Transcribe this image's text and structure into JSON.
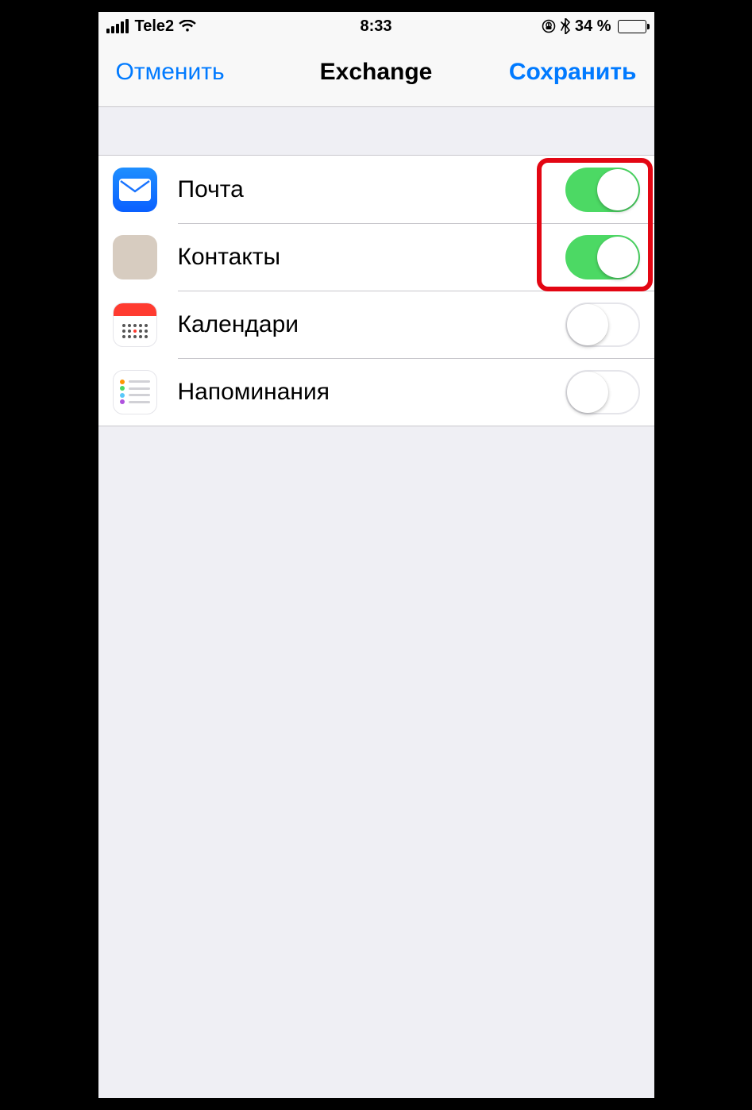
{
  "statusBar": {
    "carrier": "Tele2",
    "time": "8:33",
    "batteryPercent": "34 %"
  },
  "navBar": {
    "cancel": "Отменить",
    "title": "Exchange",
    "save": "Сохранить"
  },
  "rows": [
    {
      "key": "mail",
      "label": "Почта",
      "on": true
    },
    {
      "key": "contacts",
      "label": "Контакты",
      "on": true
    },
    {
      "key": "calendars",
      "label": "Календари",
      "on": false
    },
    {
      "key": "reminders",
      "label": "Напоминания",
      "on": false
    }
  ],
  "colors": {
    "tint": "#007aff",
    "toggleOn": "#4cd964",
    "highlight": "#e30613"
  },
  "highlight": {
    "enabled": true,
    "note": "red annotation box around first two toggles"
  }
}
